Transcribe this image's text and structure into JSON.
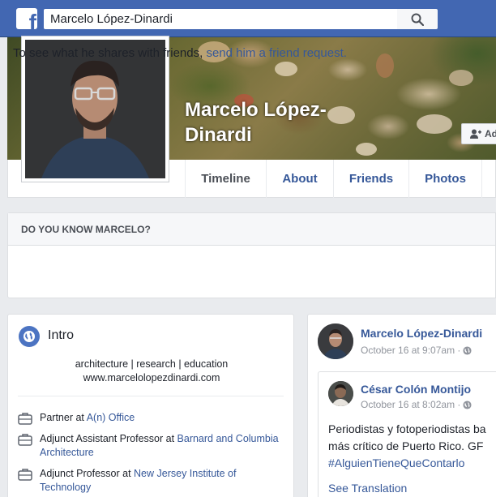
{
  "topbar": {
    "search_value": "Marcelo López-Dinardi",
    "logo_icon": "facebook-logo",
    "search_icon": "search-icon",
    "brand_color": "#4267b2"
  },
  "profile": {
    "name": "Marcelo López-Dinardi",
    "add_friend_label": "Ad",
    "tabs": [
      "Timeline",
      "About",
      "Friends",
      "Photos"
    ]
  },
  "know": {
    "heading": "DO YOU KNOW MARCELO?",
    "text": "To see what he shares with friends,",
    "link": "send him a friend request."
  },
  "intro": {
    "title": "Intro",
    "bio_line1": "architecture | research | education",
    "bio_line2": "www.marcelolopezdinardi.com",
    "work": [
      {
        "prefix": "Partner at ",
        "link": "A(n) Office"
      },
      {
        "prefix": "Adjunct Assistant Professor at ",
        "link": "Barnard and Columbia Architecture"
      },
      {
        "prefix": "Adjunct Professor at ",
        "link": "New Jersey Institute of Technology"
      }
    ]
  },
  "post": {
    "author": "Marcelo López-Dinardi",
    "time": "October 16 at 9:07am ·",
    "shared": {
      "author": "César Colón Montijo",
      "time": "October 16 at 8:02am ·",
      "text_line1": "Periodistas y fotoperiodistas ba",
      "text_line2": "más crítico de Puerto Rico. GF",
      "hashtag": "#AlguienTieneQueContarlo",
      "see_translation": "See Translation"
    }
  }
}
